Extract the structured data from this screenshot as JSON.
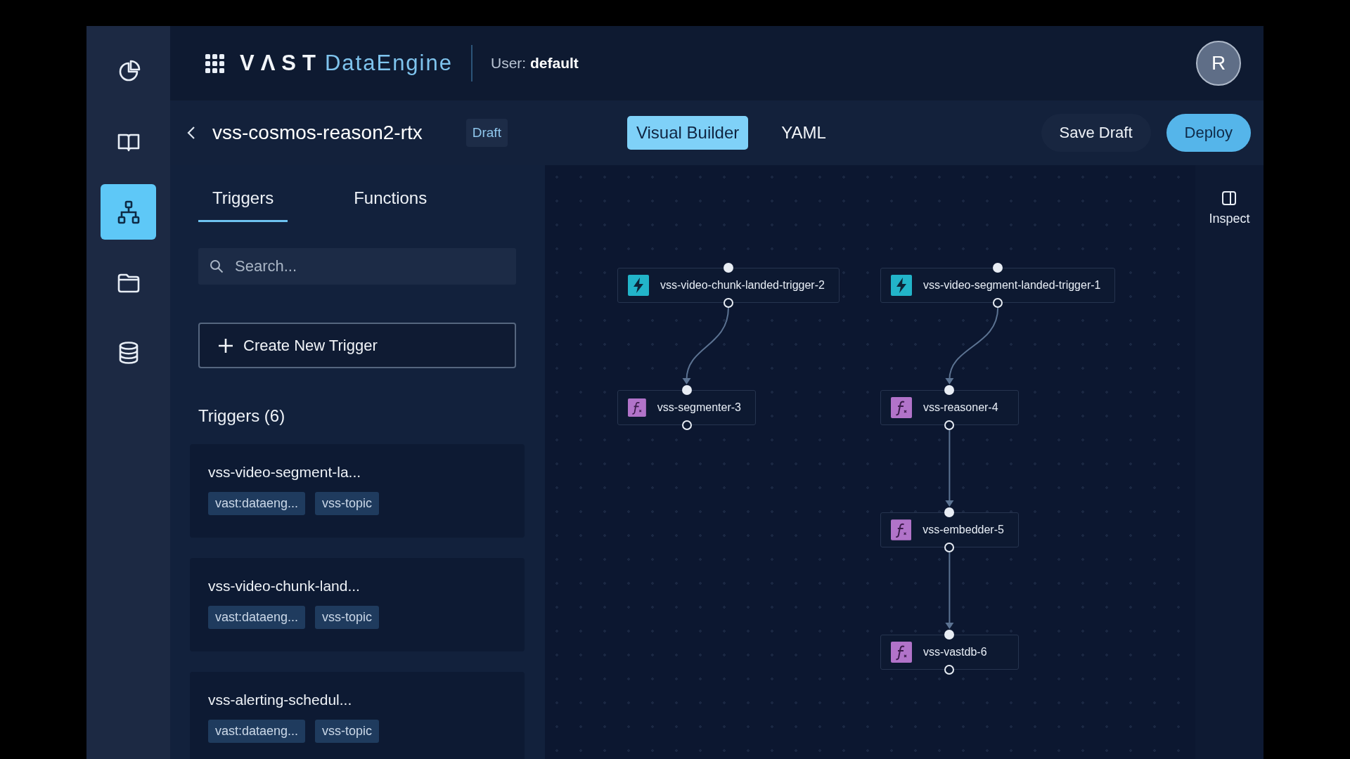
{
  "header": {
    "logo_mark": "VΛST",
    "logo_product": "DataEngine",
    "user": "User: **default**",
    "avatar": "R"
  },
  "rail": [
    {
      "selected": false
    },
    {
      "selected": false
    },
    {
      "selected": true
    },
    {
      "selected": false
    },
    {
      "selected": false
    }
  ],
  "pipeline": {
    "title": "vss-cosmos-reason2-rtx",
    "status": "Draft"
  },
  "views": [
    {
      "label": "Visual Builder",
      "selected": true
    },
    {
      "label": "YAML",
      "selected": false
    }
  ],
  "actions": [
    {
      "label": "Save Draft",
      "kind": "secondary"
    },
    {
      "label": "Deploy",
      "kind": "primary"
    }
  ],
  "panel": {
    "tabs": [
      {
        "label": "Triggers",
        "selected": true
      },
      {
        "label": "Functions",
        "selected": false
      }
    ],
    "search": {
      "placeholder": "Search..."
    },
    "create_button": "Create New Trigger",
    "list_heading": "Triggers (6)",
    "items": [
      {
        "name": "vss-video-segment-la...",
        "tags": [
          "vast:dataeng...",
          "vss-topic"
        ]
      },
      {
        "name": "vss-video-chunk-land...",
        "tags": [
          "vast:dataeng...",
          "vss-topic"
        ]
      },
      {
        "name": "vss-alerting-schedul...",
        "tags": [
          "vast:dataeng...",
          "vss-topic"
        ]
      }
    ]
  },
  "canvas": {
    "flows": [
      {
        "label": "vss-video-chunk-landed-trigger-2",
        "kind": "trigger",
        "children": [
          {
            "label": "vss-segmenter-3",
            "kind": "function"
          }
        ]
      },
      {
        "label": "vss-video-segment-landed-trigger-1",
        "kind": "trigger",
        "children": [
          {
            "label": "vss-reasoner-4",
            "kind": "function",
            "children": [
              {
                "label": "vss-embedder-5",
                "kind": "function",
                "children": [
                  {
                    "label": "vss-vastdb-6",
                    "kind": "function"
                  }
                ]
              }
            ]
          }
        ]
      }
    ]
  },
  "inspect": {
    "label": "Inspect"
  }
}
